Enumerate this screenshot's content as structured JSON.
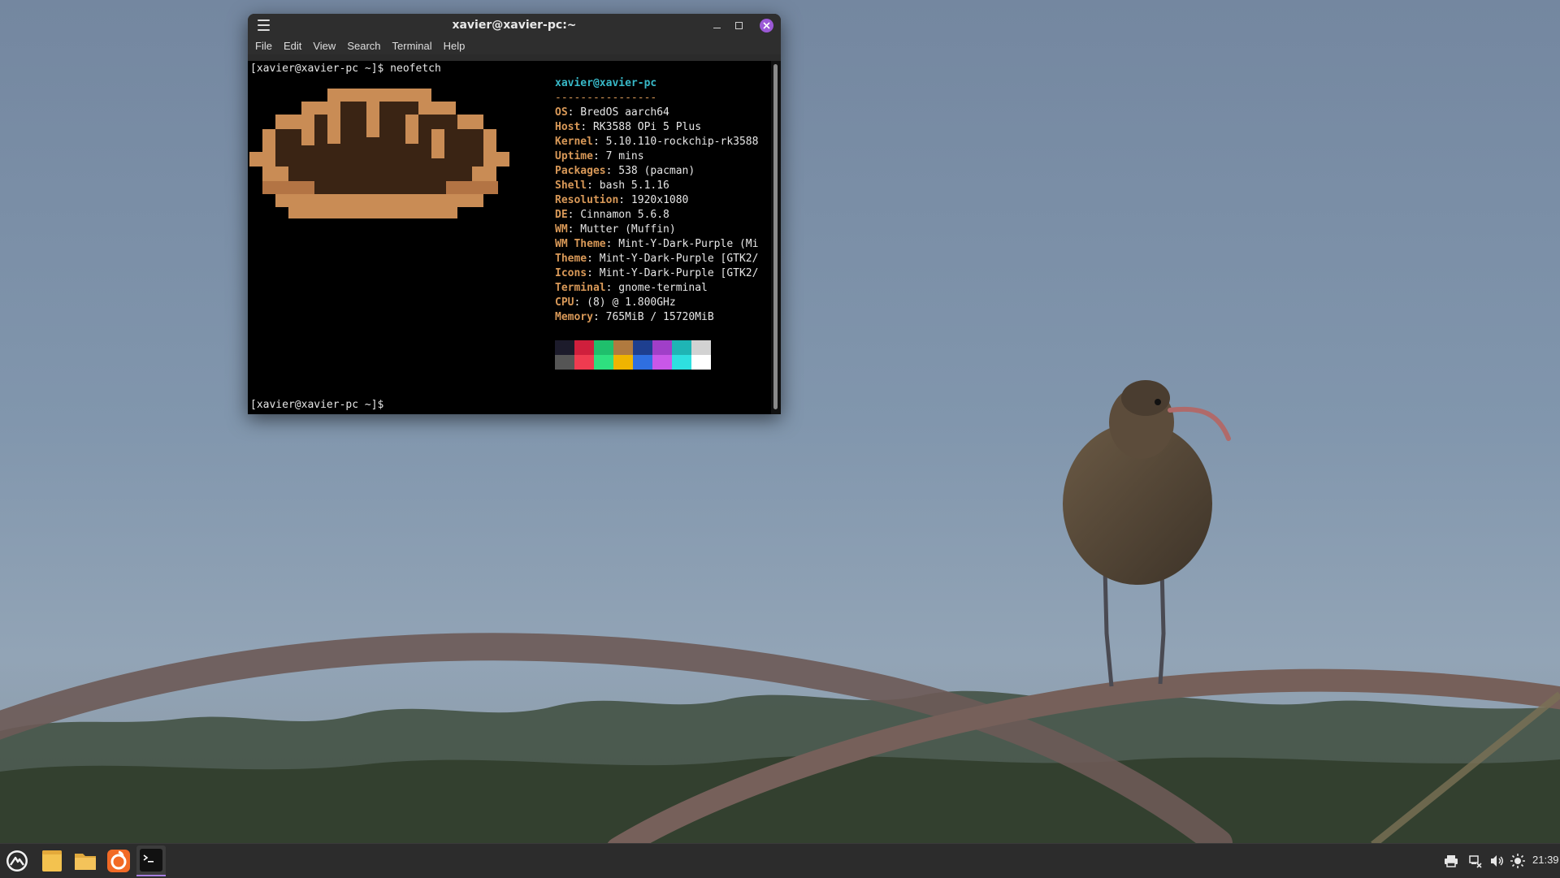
{
  "window": {
    "title": "xavier@xavier-pc:~",
    "menu": [
      "File",
      "Edit",
      "View",
      "Search",
      "Terminal",
      "Help"
    ]
  },
  "terminal": {
    "prompt1": "[xavier@xavier-pc ~]$ neofetch",
    "prompt2": "[xavier@xavier-pc ~]$ ",
    "user_host": "xavier@xavier-pc",
    "separator": "----------------",
    "info": [
      {
        "key": "OS",
        "value": ": BredOS aarch64"
      },
      {
        "key": "Host",
        "value": ": RK3588 OPi 5 Plus"
      },
      {
        "key": "Kernel",
        "value": ": 5.10.110-rockchip-rk3588"
      },
      {
        "key": "Uptime",
        "value": ": 7 mins"
      },
      {
        "key": "Packages",
        "value": ": 538 (pacman)"
      },
      {
        "key": "Shell",
        "value": ": bash 5.1.16"
      },
      {
        "key": "Resolution",
        "value": ": 1920x1080"
      },
      {
        "key": "DE",
        "value": ": Cinnamon 5.6.8"
      },
      {
        "key": "WM",
        "value": ": Mutter (Muffin)"
      },
      {
        "key": "WM Theme",
        "value": ": Mint-Y-Dark-Purple (Mi"
      },
      {
        "key": "Theme",
        "value": ": Mint-Y-Dark-Purple [GTK2/"
      },
      {
        "key": "Icons",
        "value": ": Mint-Y-Dark-Purple [GTK2/"
      },
      {
        "key": "Terminal",
        "value": ": gnome-terminal"
      },
      {
        "key": "CPU",
        "value": ": (8) @ 1.800GHz"
      },
      {
        "key": "Memory",
        "value": ": 765MiB / 15720MiB"
      }
    ],
    "palette_top": [
      "#1c1b2b",
      "#cf1f3c",
      "#1fbf6c",
      "#b07a3f",
      "#1e3f8f",
      "#a03fc8",
      "#1fb5b5",
      "#d2d2d2"
    ],
    "palette_bottom": [
      "#555555",
      "#ef3b50",
      "#2ee07f",
      "#f0b400",
      "#2f6fe0",
      "#c957e8",
      "#2ee0e0",
      "#ffffff"
    ]
  },
  "taskbar": {
    "clock": "21:39"
  }
}
